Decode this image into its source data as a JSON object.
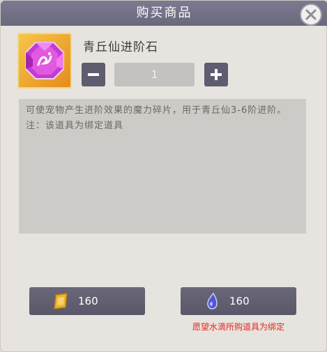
{
  "dialog": {
    "title": "购买商品",
    "close_icon": "close-icon"
  },
  "item": {
    "name": "青丘仙进阶石",
    "icon": "purple-gem-icon",
    "quantity": "1",
    "description": "可使宠物产生进阶效果的魔力碎片，用于青丘仙3-6阶进阶。注：该道具为绑定道具"
  },
  "stepper": {
    "minus_icon": "minus-icon",
    "plus_icon": "plus-icon"
  },
  "purchase": {
    "gold_price": "160",
    "gold_icon": "gold-ingot-icon",
    "water_price": "160",
    "water_icon": "water-drop-icon",
    "water_note": "愿望水滴所购道具为绑定"
  },
  "colors": {
    "title_bar": "#6a687d",
    "panel": "#cdcbc7",
    "button": "#5f5c70",
    "note_red": "#e0281f"
  }
}
